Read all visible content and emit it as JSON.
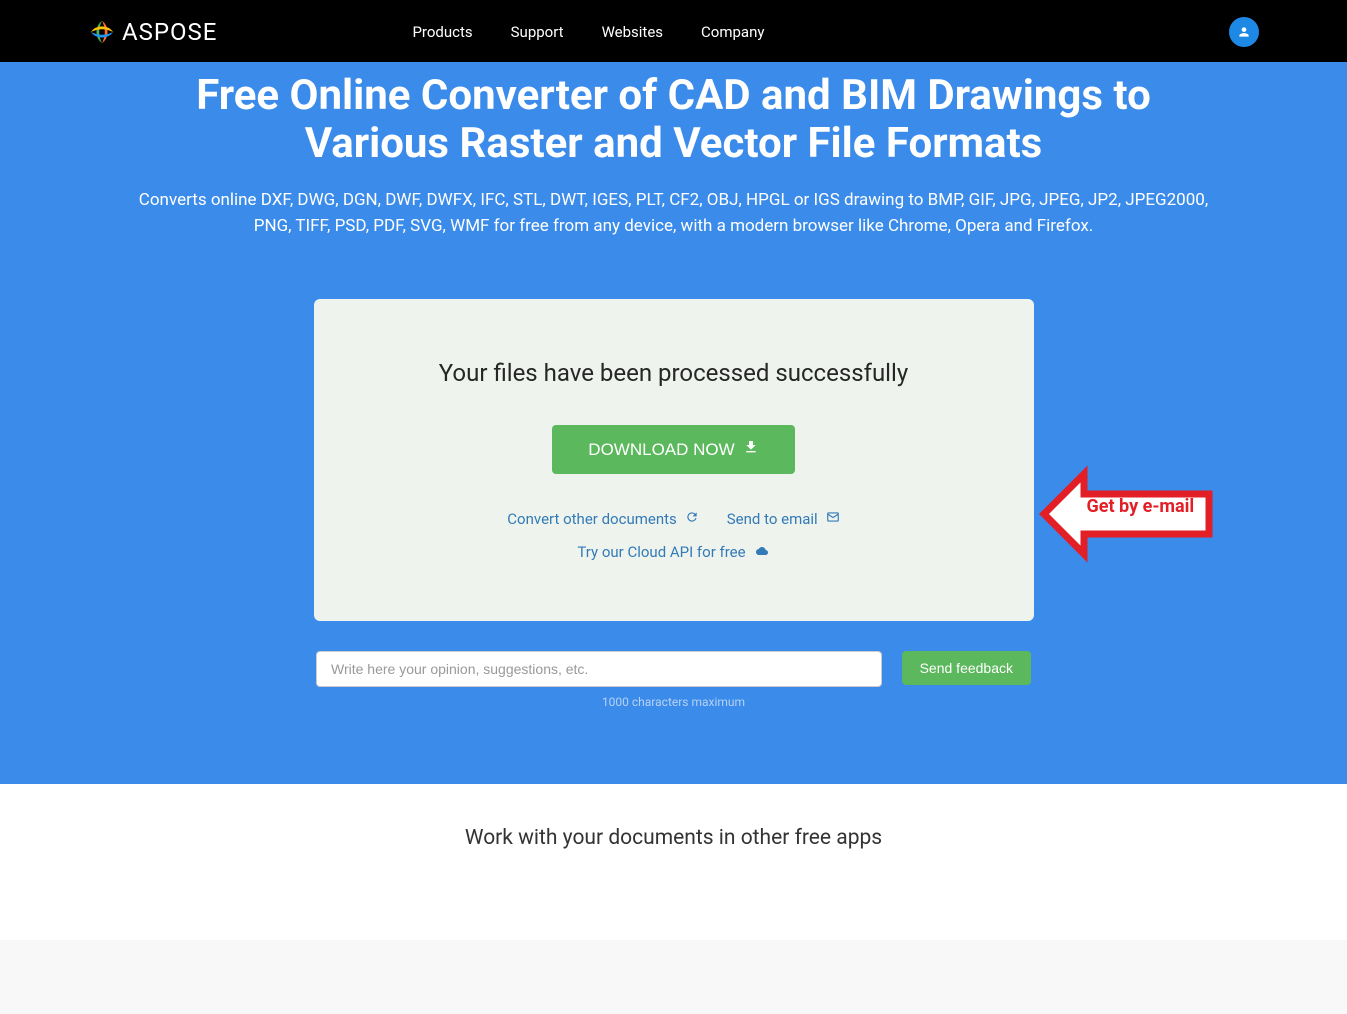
{
  "brand": {
    "name": "ASPOSE"
  },
  "nav": {
    "items": [
      "Products",
      "Support",
      "Websites",
      "Company"
    ]
  },
  "hero": {
    "title": "Free Online Converter of CAD and BIM Drawings to Various Raster and Vector File Formats",
    "description": "Converts online DXF, DWG, DGN, DWF, DWFX, IFC, STL, DWT, IGES, PLT, CF2, OBJ, HPGL or IGS drawing to BMP, GIF, JPG, JPEG, JP2, JPEG2000, PNG, TIFF, PSD, PDF, SVG, WMF for free from any device, with a modern browser like Chrome, Opera and Firefox."
  },
  "card": {
    "success": "Your files have been processed successfully",
    "download": "DOWNLOAD NOW",
    "convert_other": "Convert other documents",
    "send_email": "Send to email",
    "cloud_api": "Try our Cloud API for free"
  },
  "annotation": {
    "text": "Get by e-mail"
  },
  "feedback": {
    "placeholder": "Write here your opinion, suggestions, etc.",
    "send": "Send feedback",
    "hint": "1000 characters maximum"
  },
  "bottom": {
    "title": "Work with your documents in other free apps"
  }
}
